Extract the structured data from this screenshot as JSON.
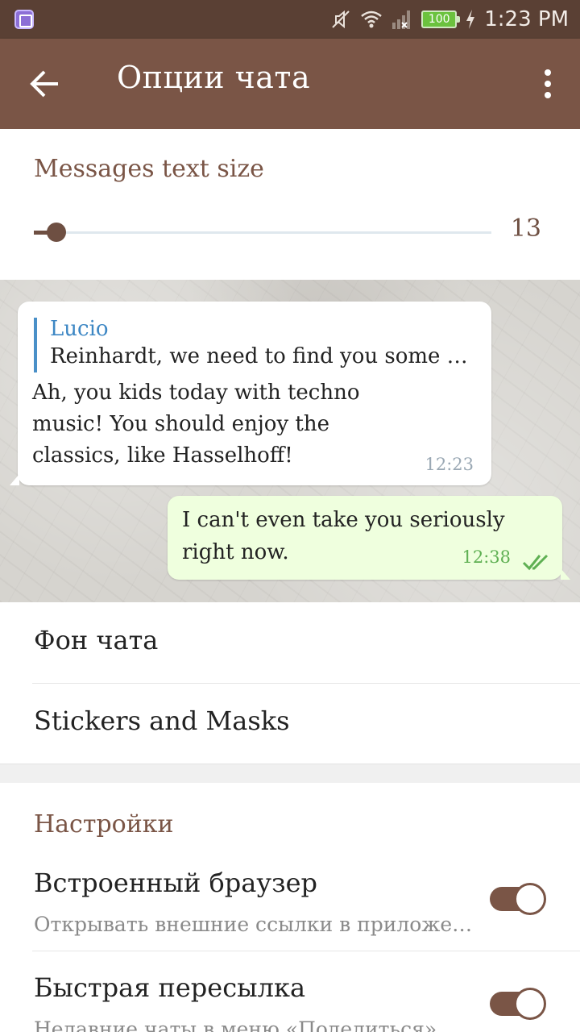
{
  "status_bar": {
    "battery": "100",
    "time": "1:23 PM"
  },
  "app_bar": {
    "title": "Опции чата"
  },
  "text_size": {
    "header": "Messages text size",
    "value": "13",
    "slider_fraction": 0.05
  },
  "chat_preview": {
    "incoming": {
      "reply_name": "Lucio",
      "reply_text": "Reinhardt, we need to find you some n...",
      "text": "Ah, you kids today with techno music! You should enjoy the classics, like Hasselhoff!",
      "time": "12:23"
    },
    "outgoing": {
      "text": "I can't even take you seriously right now.",
      "time": "12:38"
    }
  },
  "list": {
    "chat_background": "Фон чата",
    "stickers_masks": "Stickers and Masks"
  },
  "settings": {
    "header": "Настройки",
    "items": [
      {
        "title": "Встроенный браузер",
        "subtitle": "Открывать внешние ссылки в приложен...",
        "enabled": true
      },
      {
        "title": "Быстрая пересылка",
        "subtitle": "Недавние чаты в меню «Поделиться»",
        "enabled": true
      }
    ]
  },
  "colors": {
    "status_bar": "#5a4034",
    "app_bar": "#7a5546",
    "accent": "#7a5546",
    "link_blue": "#3d87c4",
    "outgoing_bubble": "#efffde"
  }
}
